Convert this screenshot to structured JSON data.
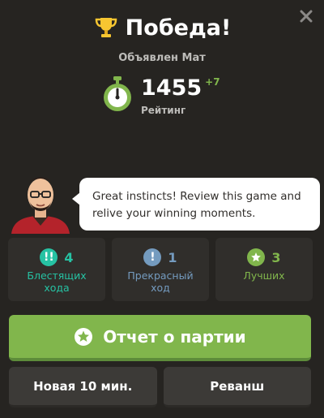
{
  "header": {
    "title": "Победа!",
    "subtitle": "Объявлен Мат",
    "close_icon": "close-icon",
    "trophy_icon": "trophy-icon"
  },
  "rating": {
    "value": "1455",
    "delta": "+7",
    "label": "Рейтинг",
    "icon": "stopwatch-icon"
  },
  "coach": {
    "message": "Great instincts! Review this game and relive your winning moments."
  },
  "stats": [
    {
      "count": "4",
      "label": "Блестящих хода",
      "icon": "brilliant-icon",
      "color": "#26c2a3"
    },
    {
      "count": "1",
      "label": "Прекрасный ход",
      "icon": "great-move-icon",
      "color": "#749bbf"
    },
    {
      "count": "3",
      "label": "Лучших",
      "icon": "best-move-icon",
      "color": "#81b64c"
    }
  ],
  "actions": {
    "review_label": "Отчет о партии",
    "new_game_label": "Новая 10 мин.",
    "rematch_label": "Реванш"
  },
  "colors": {
    "accent": "#81b64c",
    "brilliant": "#26c2a3",
    "great": "#749bbf",
    "background": "#262421"
  }
}
